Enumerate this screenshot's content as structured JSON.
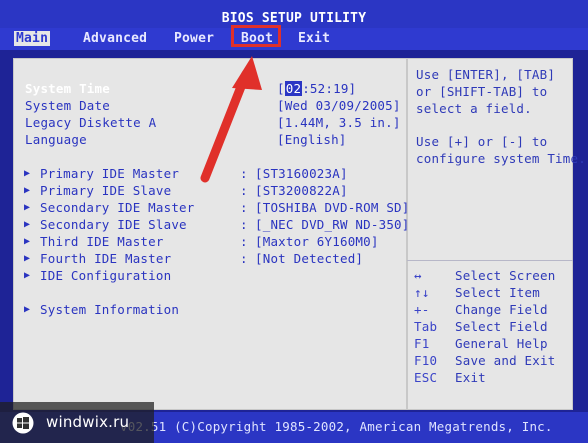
{
  "title": "BIOS SETUP UTILITY",
  "menu": {
    "items": [
      "Main",
      "Advanced",
      "Power",
      "Boot",
      "Exit"
    ],
    "active": "Main",
    "highlighted": "Boot"
  },
  "main": {
    "system_time_label": "System Time",
    "system_time_hour": "02",
    "system_time_rest": ":52:19]",
    "system_time_open": "[",
    "system_date_label": "System Date",
    "system_date_value": "[Wed 03/09/2005]",
    "legacy_diskette_label": "Legacy Diskette A",
    "legacy_diskette_value": "[1.44M, 3.5 in.]",
    "language_label": "Language",
    "language_value": "[English]",
    "ide": [
      {
        "label": "Primary IDE Master",
        "value": "[ST3160023A]"
      },
      {
        "label": "Primary IDE Slave",
        "value": "[ST3200822A]"
      },
      {
        "label": "Secondary IDE Master",
        "value": "[TOSHIBA DVD-ROM SD]"
      },
      {
        "label": "Secondary IDE Slave",
        "value": "[_NEC DVD_RW ND-350]"
      },
      {
        "label": "Third IDE Master",
        "value": "[Maxtor 6Y160M0]"
      },
      {
        "label": "Fourth IDE Master",
        "value": "[Not Detected]"
      }
    ],
    "ide_config_label": "IDE Configuration",
    "system_info_label": "System Information",
    "separator": ":",
    "submenu_marker": "▶"
  },
  "help": {
    "line1": "Use [ENTER], [TAB]",
    "line2": "or [SHIFT-TAB] to",
    "line3": "select a field.",
    "line4": "Use [+] or [-] to",
    "line5": "configure system Time.",
    "keys": [
      {
        "key": "↔",
        "desc": "Select Screen"
      },
      {
        "key": "↑↓",
        "desc": "Select Item"
      },
      {
        "key": "+-",
        "desc": "Change Field"
      },
      {
        "key": "Tab",
        "desc": "Select Field"
      },
      {
        "key": "F1",
        "desc": "General Help"
      },
      {
        "key": "F10",
        "desc": "Save and Exit"
      },
      {
        "key": "ESC",
        "desc": "Exit"
      }
    ]
  },
  "footer": {
    "copyright": "v02.51 (C)Copyright 1985-2002, American Megatrends, Inc."
  },
  "watermark": {
    "text": "windwix.ru",
    "icon": "windows-logo-icon"
  },
  "annotation": {
    "color": "#e0302a",
    "icon": "red-arrow-icon"
  }
}
